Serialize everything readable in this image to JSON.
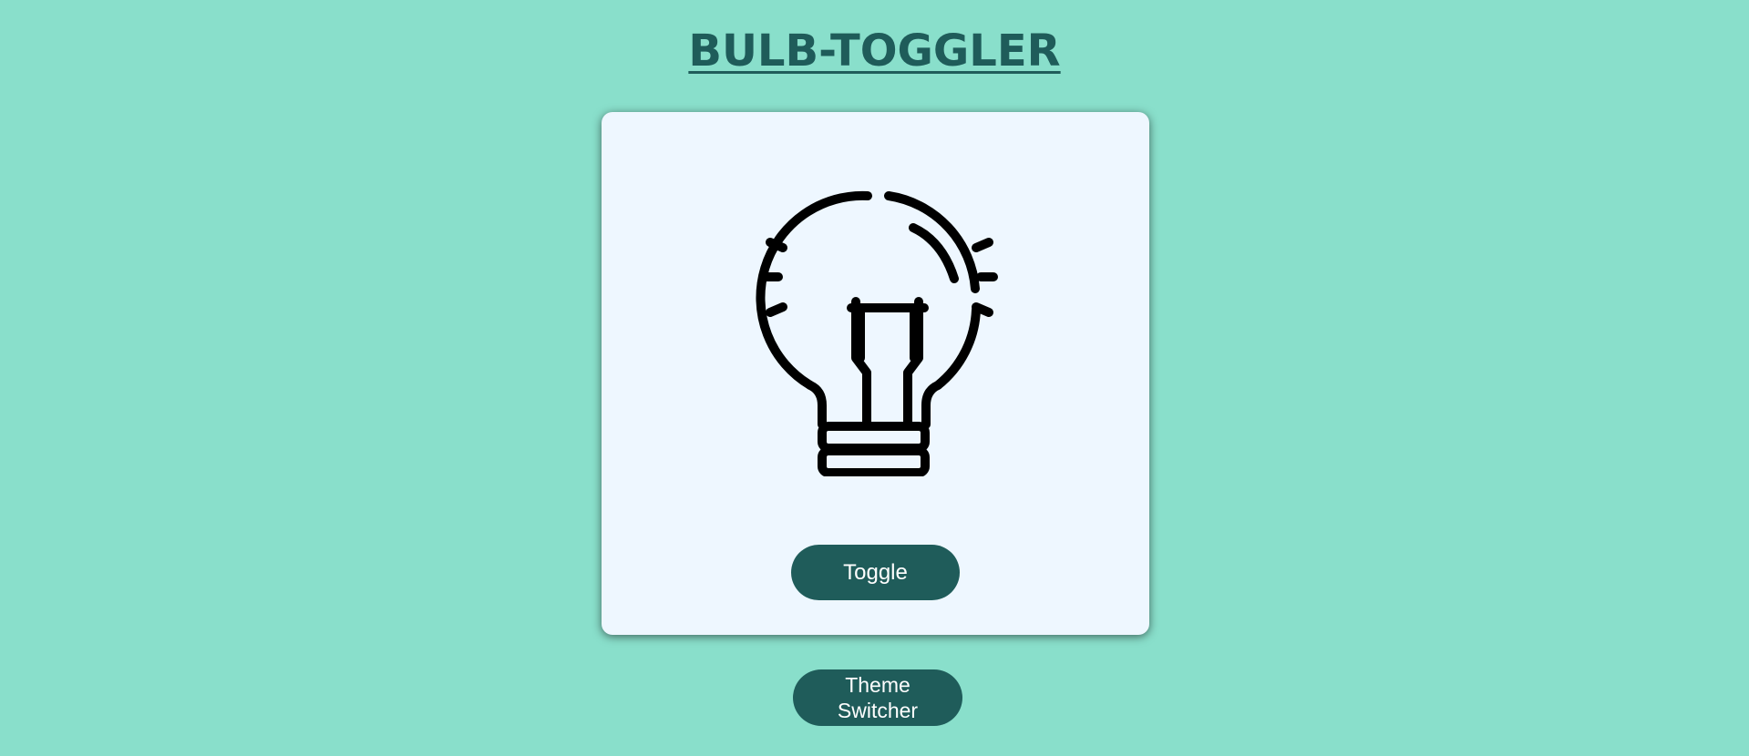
{
  "page": {
    "title": "BULB-TOGGLER",
    "background_color": "#89dfcb",
    "accent_color": "#1f5c5a"
  },
  "card": {
    "background_color": "#eef7ff",
    "bulb": {
      "icon": "lightbulb-icon",
      "state": "off",
      "stroke_color": "#000000"
    },
    "toggle_label": "Toggle"
  },
  "theme_switcher": {
    "label_line1": "Theme",
    "label_line2": "Switcher"
  }
}
